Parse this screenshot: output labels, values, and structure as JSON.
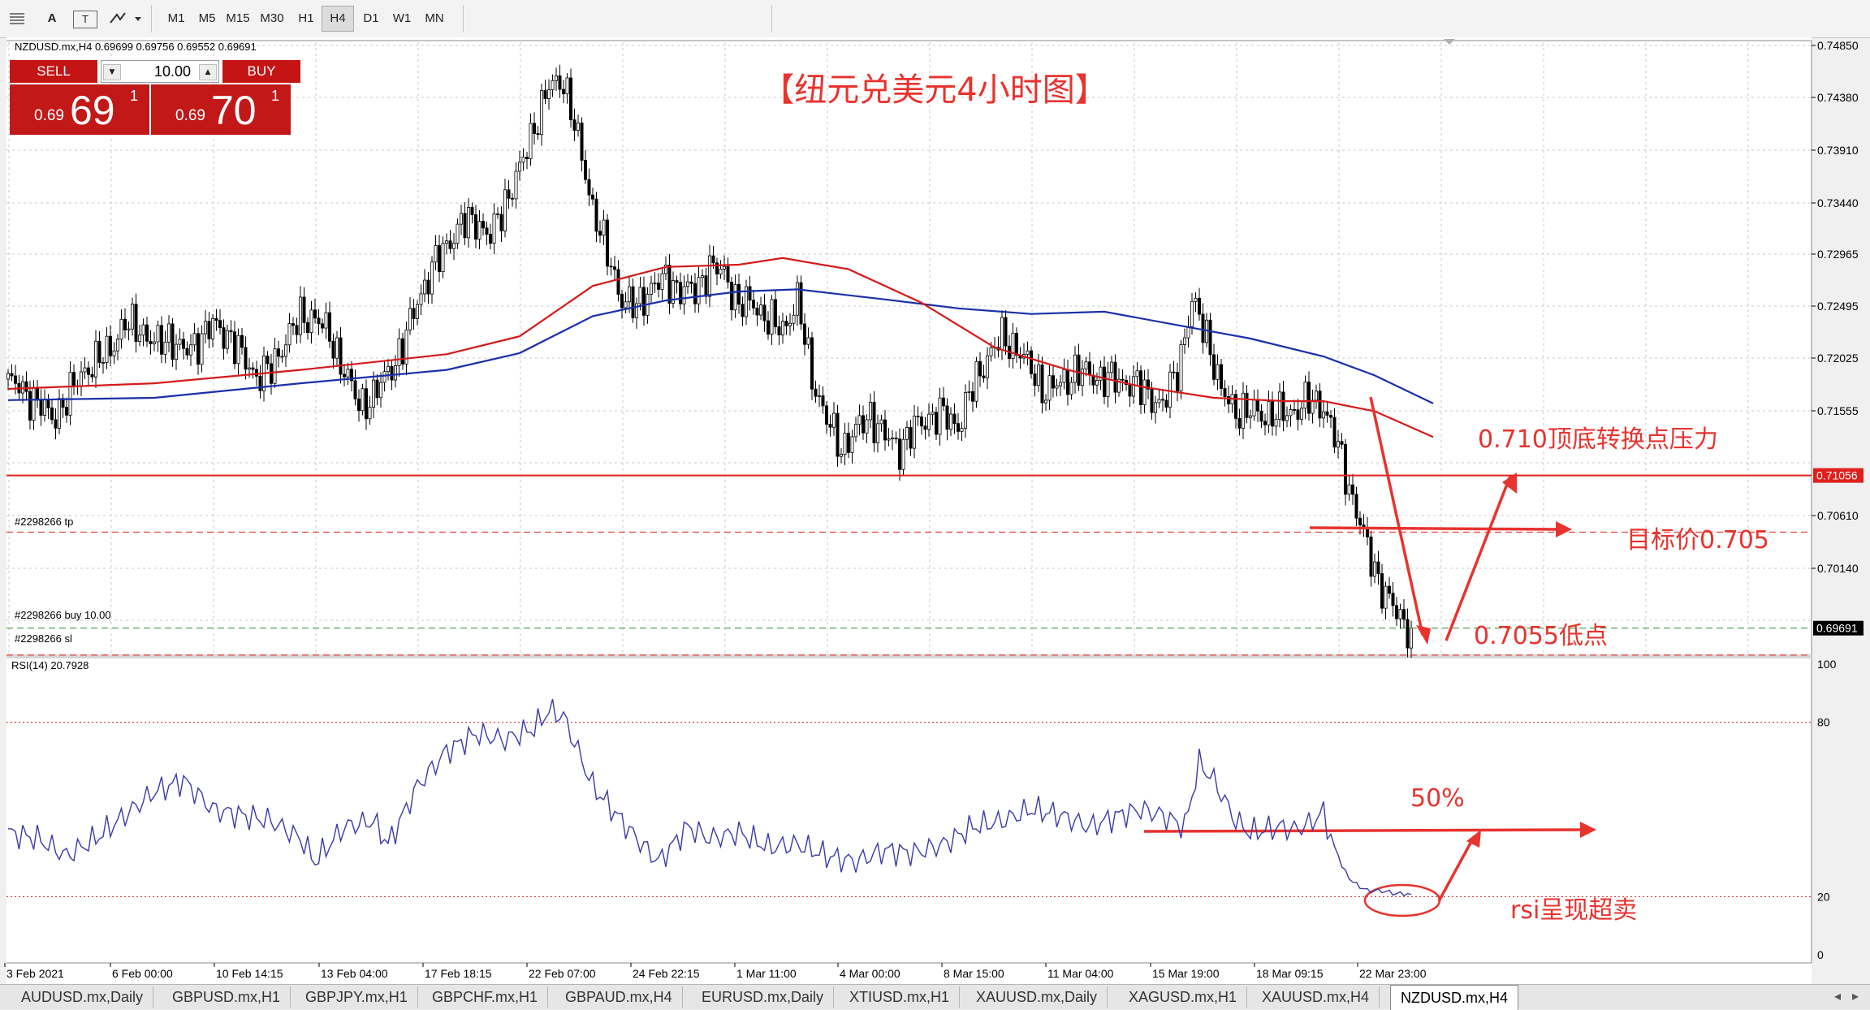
{
  "toolbar": {
    "tools": [
      "A",
      "T"
    ],
    "timeframes": [
      "M1",
      "M5",
      "M15",
      "M30",
      "H1",
      "H4",
      "D1",
      "W1",
      "MN"
    ],
    "active_timeframe": "H4"
  },
  "chart": {
    "info": "NZDUSD.mx,H4  0.69699 0.69756 0.69552 0.69691",
    "title_annotation": "【纽元兑美元4小时图】",
    "price_axis": [
      "0.74850",
      "0.74380",
      "0.73910",
      "0.73440",
      "0.72965",
      "0.72495",
      "0.72025",
      "0.71555",
      "0.70610",
      "0.70140"
    ],
    "price_tags": [
      {
        "price": 0.71056,
        "label": "0.71056",
        "color": "#e0201c"
      },
      {
        "price": 0.69691,
        "label": "0.69691",
        "color": "#000000"
      }
    ],
    "orders": {
      "tp": "#2298266 tp",
      "buy": "#2298266 buy 10.00",
      "sl": "#2298266 sl"
    },
    "annotations": {
      "resistance": "0.710顶底转换点压力",
      "target": "目标价0.705",
      "low": "0.7055低点",
      "rsi_fifty": "50%",
      "rsi_oversold": "rsi呈现超卖"
    },
    "date_axis": [
      "3 Feb 2021",
      "6 Feb 00:00",
      "10 Feb 14:15",
      "13 Feb 04:00",
      "17 Feb 18:15",
      "22 Feb 07:00",
      "24 Feb 22:15",
      "1 Mar 11:00",
      "4 Mar 00:00",
      "8 Mar 15:00",
      "11 Mar 04:00",
      "15 Mar 19:00",
      "18 Mar 09:15",
      "22 Mar 23:00"
    ]
  },
  "trade_panel": {
    "sell_label": "SELL",
    "buy_label": "BUY",
    "lot": "10.00",
    "sell_prefix": "0.69",
    "sell_big": "69",
    "sell_sup": "1",
    "buy_prefix": "0.69",
    "buy_big": "70",
    "buy_sup": "1"
  },
  "rsi": {
    "label": "RSI(14) 20.7928",
    "axis": [
      "100",
      "80",
      "20",
      "0"
    ]
  },
  "tabs": [
    "AUDUSD.mx,Daily",
    "GBPUSD.mx,H1",
    "GBPJPY.mx,H1",
    "GBPCHF.mx,H1",
    "GBPAUD.mx,H4",
    "EURUSD.mx,Daily",
    "XTIUSD.mx,H1",
    "XAUUSD.mx,Daily",
    "XAGUSD.mx,H1",
    "XAUUSD.mx,H4",
    "NZDUSD.mx,H4"
  ],
  "active_tab": "NZDUSD.mx,H4",
  "colors": {
    "up_candle": "#ffffff",
    "down_candle": "#000000",
    "ma_fast": "#d41a1a",
    "ma_slow": "#1a2fa8",
    "rsi_line": "#3a3aa8",
    "annotation": "#e8332e"
  },
  "chart_data": {
    "type": "candlestick",
    "symbol": "NZDUSD.mx",
    "timeframe": "H4",
    "ylim": [
      0.695,
      0.749
    ],
    "path": [
      [
        0,
        0.719
      ],
      [
        4,
        0.7182
      ],
      [
        8,
        0.717
      ],
      [
        12,
        0.7158
      ],
      [
        16,
        0.7172
      ],
      [
        20,
        0.7198
      ],
      [
        24,
        0.7206
      ],
      [
        28,
        0.722
      ],
      [
        32,
        0.724
      ],
      [
        36,
        0.7238
      ],
      [
        40,
        0.7222
      ],
      [
        44,
        0.723
      ],
      [
        48,
        0.7215
      ],
      [
        52,
        0.7226
      ],
      [
        56,
        0.724
      ],
      [
        60,
        0.7232
      ],
      [
        64,
        0.7212
      ],
      [
        68,
        0.7195
      ],
      [
        72,
        0.72
      ],
      [
        76,
        0.7228
      ],
      [
        80,
        0.7246
      ],
      [
        84,
        0.7248
      ],
      [
        88,
        0.723
      ],
      [
        92,
        0.72
      ],
      [
        96,
        0.7168
      ],
      [
        100,
        0.7176
      ],
      [
        104,
        0.7198
      ],
      [
        108,
        0.722
      ],
      [
        112,
        0.7262
      ],
      [
        116,
        0.729
      ],
      [
        120,
        0.7312
      ],
      [
        124,
        0.733
      ],
      [
        128,
        0.7334
      ],
      [
        132,
        0.7318
      ],
      [
        136,
        0.735
      ],
      [
        140,
        0.7378
      ],
      [
        144,
        0.7418
      ],
      [
        148,
        0.7452
      ],
      [
        152,
        0.746
      ],
      [
        156,
        0.7404
      ],
      [
        160,
        0.7346
      ],
      [
        164,
        0.7302
      ],
      [
        168,
        0.7264
      ],
      [
        172,
        0.7255
      ],
      [
        176,
        0.7275
      ],
      [
        180,
        0.728
      ],
      [
        184,
        0.7272
      ],
      [
        188,
        0.727
      ],
      [
        192,
        0.7292
      ],
      [
        196,
        0.7286
      ],
      [
        200,
        0.7258
      ],
      [
        204,
        0.726
      ],
      [
        208,
        0.7244
      ],
      [
        212,
        0.7236
      ],
      [
        216,
        0.7262
      ],
      [
        220,
        0.7194
      ],
      [
        224,
        0.7155
      ],
      [
        228,
        0.713
      ],
      [
        232,
        0.7145
      ],
      [
        236,
        0.716
      ],
      [
        240,
        0.714
      ],
      [
        244,
        0.713
      ],
      [
        248,
        0.7148
      ],
      [
        252,
        0.7158
      ],
      [
        256,
        0.716
      ],
      [
        260,
        0.715
      ],
      [
        264,
        0.7184
      ],
      [
        268,
        0.7212
      ],
      [
        272,
        0.7228
      ],
      [
        276,
        0.722
      ],
      [
        280,
        0.72
      ],
      [
        284,
        0.718
      ],
      [
        288,
        0.7188
      ],
      [
        292,
        0.7198
      ],
      [
        296,
        0.7196
      ],
      [
        300,
        0.7192
      ],
      [
        304,
        0.719
      ],
      [
        308,
        0.7188
      ],
      [
        312,
        0.7178
      ],
      [
        316,
        0.7168
      ],
      [
        320,
        0.72
      ],
      [
        324,
        0.726
      ],
      [
        328,
        0.7232
      ],
      [
        332,
        0.718
      ],
      [
        336,
        0.7164
      ],
      [
        340,
        0.7162
      ],
      [
        344,
        0.716
      ],
      [
        348,
        0.716
      ],
      [
        352,
        0.7164
      ],
      [
        356,
        0.7172
      ],
      [
        360,
        0.7168
      ],
      [
        364,
        0.713
      ],
      [
        368,
        0.7085
      ],
      [
        372,
        0.704
      ],
      [
        376,
        0.7005
      ],
      [
        380,
        0.6982
      ],
      [
        384,
        0.6969
      ]
    ],
    "ma_fast": [
      [
        0,
        0.7183
      ],
      [
        40,
        0.7188
      ],
      [
        80,
        0.72
      ],
      [
        120,
        0.7214
      ],
      [
        140,
        0.723
      ],
      [
        160,
        0.7275
      ],
      [
        180,
        0.7292
      ],
      [
        200,
        0.7294
      ],
      [
        212,
        0.73
      ],
      [
        230,
        0.729
      ],
      [
        250,
        0.726
      ],
      [
        270,
        0.722
      ],
      [
        290,
        0.72
      ],
      [
        310,
        0.7185
      ],
      [
        330,
        0.7175
      ],
      [
        350,
        0.7172
      ],
      [
        360,
        0.7172
      ],
      [
        374,
        0.7163
      ],
      [
        390,
        0.714
      ]
    ],
    "ma_slow": [
      [
        0,
        0.7173
      ],
      [
        40,
        0.7175
      ],
      [
        80,
        0.7188
      ],
      [
        120,
        0.72
      ],
      [
        140,
        0.7215
      ],
      [
        160,
        0.7248
      ],
      [
        180,
        0.7262
      ],
      [
        200,
        0.727
      ],
      [
        216,
        0.7272
      ],
      [
        240,
        0.7263
      ],
      [
        260,
        0.7255
      ],
      [
        280,
        0.725
      ],
      [
        300,
        0.7252
      ],
      [
        320,
        0.724
      ],
      [
        340,
        0.7228
      ],
      [
        360,
        0.7212
      ],
      [
        374,
        0.7195
      ],
      [
        390,
        0.717
      ]
    ],
    "levels": {
      "resistance": 0.71056,
      "take_profit": 0.7055,
      "entry": 0.69691,
      "stop_loss": 0.6945
    },
    "rsi": {
      "period": 14,
      "current": 20.7928,
      "levels": [
        80,
        20
      ],
      "path": [
        [
          0,
          42
        ],
        [
          8,
          40
        ],
        [
          16,
          34
        ],
        [
          24,
          40
        ],
        [
          32,
          48
        ],
        [
          40,
          56
        ],
        [
          48,
          60
        ],
        [
          56,
          50
        ],
        [
          64,
          48
        ],
        [
          72,
          46
        ],
        [
          80,
          40
        ],
        [
          84,
          32
        ],
        [
          92,
          44
        ],
        [
          100,
          46
        ],
        [
          104,
          38
        ],
        [
          112,
          58
        ],
        [
          120,
          70
        ],
        [
          128,
          76
        ],
        [
          136,
          74
        ],
        [
          144,
          78
        ],
        [
          148,
          84
        ],
        [
          152,
          82
        ],
        [
          160,
          58
        ],
        [
          164,
          52
        ],
        [
          172,
          40
        ],
        [
          178,
          32
        ],
        [
          186,
          44
        ],
        [
          192,
          40
        ],
        [
          200,
          42
        ],
        [
          208,
          37
        ],
        [
          216,
          38
        ],
        [
          224,
          34
        ],
        [
          232,
          32
        ],
        [
          240,
          36
        ],
        [
          248,
          35
        ],
        [
          256,
          38
        ],
        [
          264,
          44
        ],
        [
          272,
          46
        ],
        [
          280,
          50
        ],
        [
          288,
          48
        ],
        [
          296,
          44
        ],
        [
          304,
          48
        ],
        [
          310,
          50
        ],
        [
          316,
          48
        ],
        [
          322,
          44
        ],
        [
          326,
          66
        ],
        [
          330,
          60
        ],
        [
          336,
          46
        ],
        [
          340,
          42
        ],
        [
          348,
          44
        ],
        [
          352,
          43
        ],
        [
          356,
          45
        ],
        [
          360,
          49
        ],
        [
          364,
          32
        ],
        [
          368,
          25
        ],
        [
          372,
          22
        ],
        [
          376,
          22
        ],
        [
          380,
          21
        ],
        [
          384,
          21
        ]
      ]
    }
  }
}
